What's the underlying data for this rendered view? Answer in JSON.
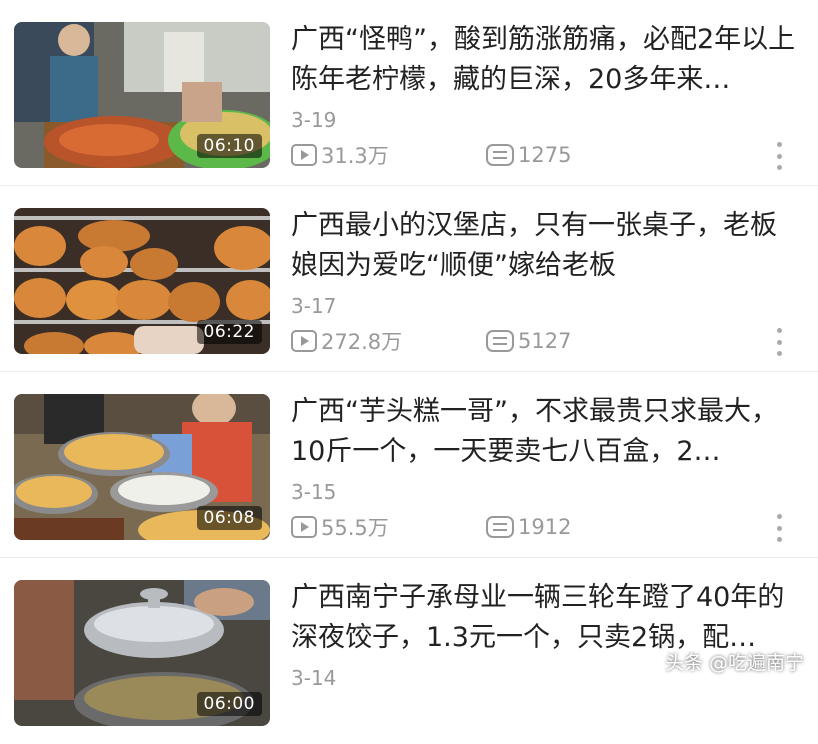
{
  "videos": [
    {
      "title": "广西“怪鸭”，酸到筋涨筋痛，必配2年以上陈年老柠檬，藏的巨深，20多年来…",
      "duration": "06:10",
      "date": "3-19",
      "views": "31.3万",
      "comments": "1275"
    },
    {
      "title": "广西最小的汉堡店，只有一张桌子，老板娘因为爱吃“顺便”嫁给老板",
      "duration": "06:22",
      "date": "3-17",
      "views": "272.8万",
      "comments": "5127"
    },
    {
      "title": "广西“芋头糕一哥”，不求最贵只求最大，10斤一个，一天要卖七八百盒，2…",
      "duration": "06:08",
      "date": "3-15",
      "views": "55.5万",
      "comments": "1912"
    },
    {
      "title": "广西南宁子承母业一辆三轮车蹬了40年的深夜饺子，1.3元一个，只卖2锅，配…",
      "duration": "06:00",
      "date": "3-14",
      "views": "",
      "comments": ""
    }
  ],
  "watermark": "头条 @吃遍南宁",
  "icons": {
    "views": "play-icon",
    "comments": "comment-icon",
    "more": "more-vertical-icon"
  },
  "colors": {
    "title": "#222222",
    "meta": "#999999",
    "divider": "#ececec"
  }
}
